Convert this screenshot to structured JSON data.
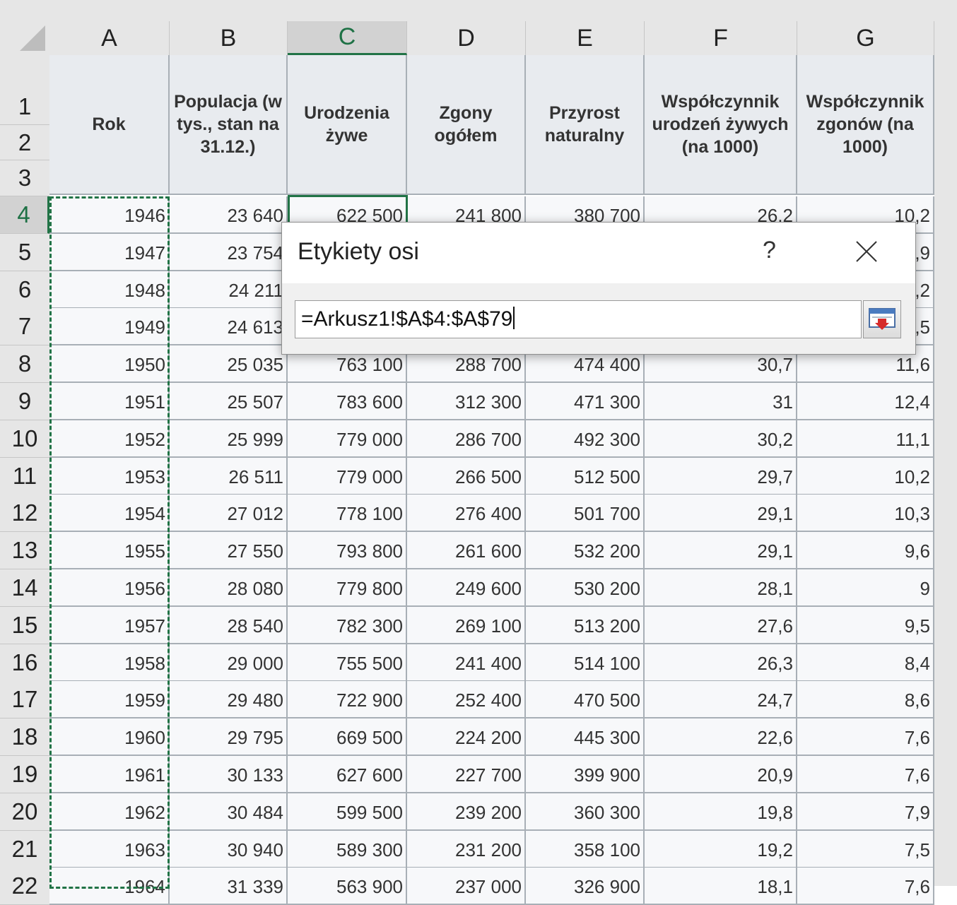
{
  "columns": [
    "A",
    "B",
    "C",
    "D",
    "E",
    "F",
    "G"
  ],
  "selected_column": "C",
  "row_numbers": [
    "1",
    "2",
    "3",
    "4",
    "5",
    "6",
    "7",
    "8",
    "9",
    "10",
    "11",
    "12",
    "13",
    "14",
    "15",
    "16",
    "17",
    "18",
    "19",
    "20",
    "21",
    "22"
  ],
  "selected_row": "4",
  "headers": [
    "Rok",
    "Populacja (w tys., stan na 31.12.)",
    "Urodzenia żywe",
    "Zgony ogółem",
    "Przyrost naturalny",
    "Współczynnik urodzeń żywych (na 1000)",
    "Współczynnik zgonów (na 1000)"
  ],
  "rows": [
    [
      "1946",
      "23 640",
      "622 500",
      "241 800",
      "380 700",
      "26,2",
      "10,2"
    ],
    [
      "1947",
      "23 754",
      "",
      "",
      "",
      "",
      ",9"
    ],
    [
      "1948",
      "24 211",
      "",
      "",
      "",
      "",
      ",2"
    ],
    [
      "1949",
      "24 613",
      "",
      "",
      "",
      "",
      ",5"
    ],
    [
      "1950",
      "25 035",
      "763 100",
      "288 700",
      "474 400",
      "30,7",
      "11,6"
    ],
    [
      "1951",
      "25 507",
      "783 600",
      "312 300",
      "471 300",
      "31",
      "12,4"
    ],
    [
      "1952",
      "25 999",
      "779 000",
      "286 700",
      "492 300",
      "30,2",
      "11,1"
    ],
    [
      "1953",
      "26 511",
      "779 000",
      "266 500",
      "512 500",
      "29,7",
      "10,2"
    ],
    [
      "1954",
      "27 012",
      "778 100",
      "276 400",
      "501 700",
      "29,1",
      "10,3"
    ],
    [
      "1955",
      "27 550",
      "793 800",
      "261 600",
      "532 200",
      "29,1",
      "9,6"
    ],
    [
      "1956",
      "28 080",
      "779 800",
      "249 600",
      "530 200",
      "28,1",
      "9"
    ],
    [
      "1957",
      "28 540",
      "782 300",
      "269 100",
      "513 200",
      "27,6",
      "9,5"
    ],
    [
      "1958",
      "29 000",
      "755 500",
      "241 400",
      "514 100",
      "26,3",
      "8,4"
    ],
    [
      "1959",
      "29 480",
      "722 900",
      "252 400",
      "470 500",
      "24,7",
      "8,6"
    ],
    [
      "1960",
      "29 795",
      "669 500",
      "224 200",
      "445 300",
      "22,6",
      "7,6"
    ],
    [
      "1961",
      "30 133",
      "627 600",
      "227 700",
      "399 900",
      "20,9",
      "7,6"
    ],
    [
      "1962",
      "30 484",
      "599 500",
      "239 200",
      "360 300",
      "19,8",
      "7,9"
    ],
    [
      "1963",
      "30 940",
      "589 300",
      "231 200",
      "358 100",
      "19,2",
      "7,5"
    ],
    [
      "1964",
      "31 339",
      "563 900",
      "237 000",
      "326 900",
      "18,1",
      "7,6"
    ]
  ],
  "dialog": {
    "title": "Etykiety osi",
    "help": "?",
    "range_value": "=Arkusz1!$A$4:$A$79"
  },
  "colors": {
    "excel_green": "#217346",
    "header_gray": "#e6e6e6",
    "grid_border": "#a8afb6"
  }
}
